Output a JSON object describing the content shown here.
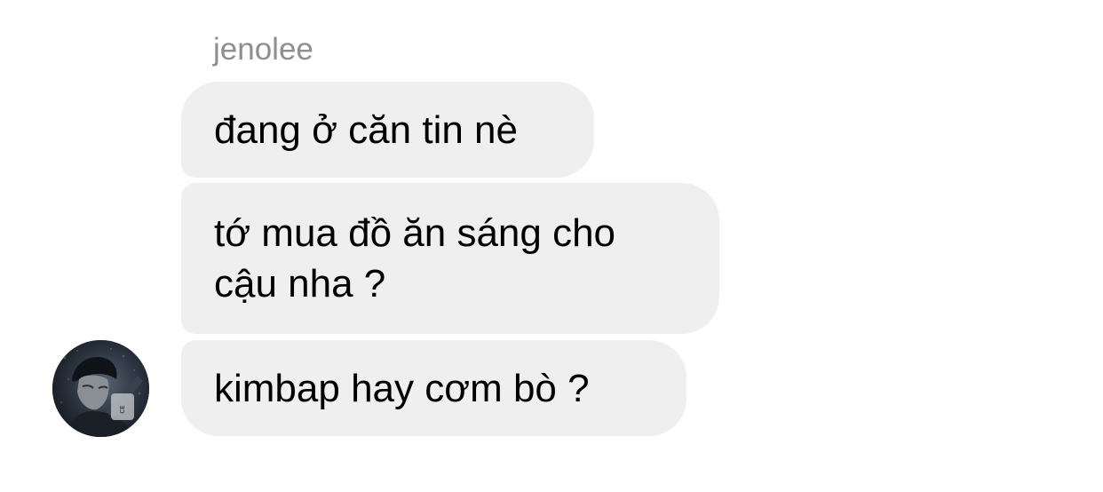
{
  "conversation": {
    "sender": "jenolee",
    "messages": [
      {
        "text": "đang ở căn tin nè"
      },
      {
        "text": "tớ mua đồ ăn sáng cho\ncậu nha ?"
      },
      {
        "text": "kimbap hay cơm bò ?"
      }
    ]
  },
  "colors": {
    "bubble": "#efefef",
    "sender_name": "#8e8e93",
    "text": "#000000"
  }
}
